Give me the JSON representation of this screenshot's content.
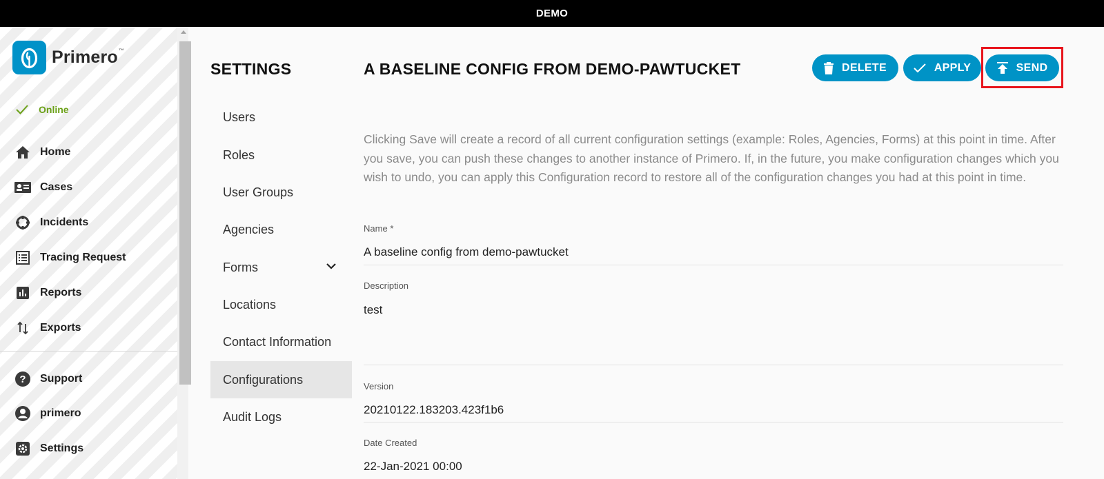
{
  "topbar": {
    "label": "DEMO"
  },
  "sidebar": {
    "logo_text": "Primero",
    "logo_tm": "™",
    "status": "Online",
    "items": [
      {
        "label": "Home",
        "icon": "home-icon"
      },
      {
        "label": "Cases",
        "icon": "cases-icon"
      },
      {
        "label": "Incidents",
        "icon": "incidents-icon"
      },
      {
        "label": "Tracing Request",
        "icon": "tracing-request-icon"
      },
      {
        "label": "Reports",
        "icon": "reports-icon"
      },
      {
        "label": "Exports",
        "icon": "exports-icon"
      }
    ],
    "bottom_items": [
      {
        "label": "Support",
        "icon": "help-icon"
      },
      {
        "label": "primero",
        "icon": "account-icon"
      },
      {
        "label": "Settings",
        "icon": "settings-gear-icon"
      }
    ]
  },
  "settings_menu": {
    "title": "SETTINGS",
    "items": [
      {
        "label": "Users"
      },
      {
        "label": "Roles"
      },
      {
        "label": "User Groups"
      },
      {
        "label": "Agencies"
      },
      {
        "label": "Forms"
      },
      {
        "label": "Locations"
      },
      {
        "label": "Contact Information"
      },
      {
        "label": "Configurations",
        "active": true
      },
      {
        "label": "Audit Logs"
      }
    ]
  },
  "page": {
    "title": "A BASELINE CONFIG FROM DEMO-PAWTUCKET",
    "buttons": {
      "delete": "DELETE",
      "apply": "APPLY",
      "send": "SEND"
    },
    "intro": "Clicking Save will create a record of all current configuration settings (example: Roles, Agencies, Forms) at this point in time. After you save, you can push these changes to another instance of Primero. If, in the future, you make configuration changes which you wish to undo, you can apply this Configuration record to restore all of the configuration changes you had at this point in time.",
    "fields": {
      "name_label": "Name",
      "name_required": "*",
      "name_value": "A baseline config from demo-pawtucket",
      "description_label": "Description",
      "description_value": "test",
      "version_label": "Version",
      "version_value": "20210122.183203.423f1b6",
      "date_label": "Date Created",
      "date_value": "22-Jan-2021 00:00"
    }
  },
  "colors": {
    "accent": "#0093c6",
    "online": "#6aa016",
    "highlight": "#e8151d",
    "topbar": "#000000"
  }
}
